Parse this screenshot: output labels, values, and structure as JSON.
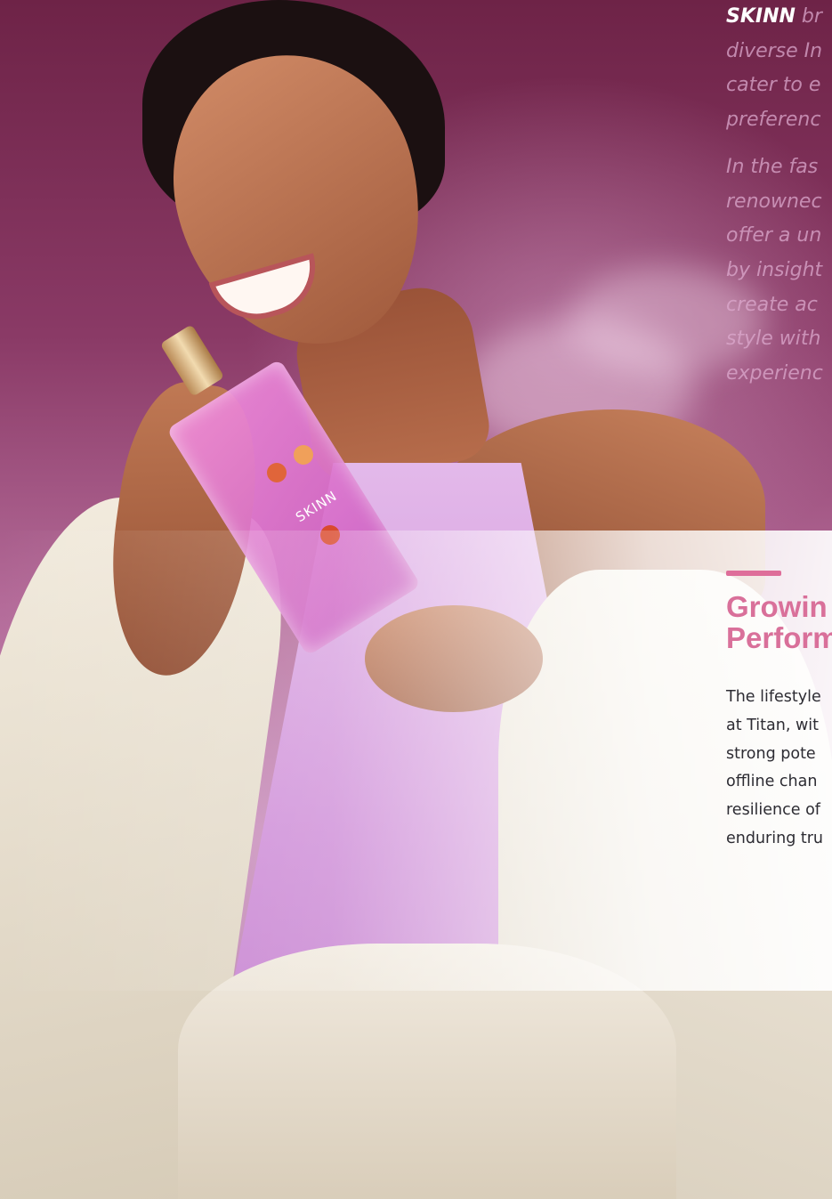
{
  "intro": {
    "brand": "SKINN",
    "paragraph1_rest": [
      " br",
      "diverse In",
      "cater to e",
      "preferenc"
    ],
    "paragraph2": [
      "In the fas",
      "renownec",
      "offer a un",
      "by insight",
      "create ac",
      "style with",
      "experienc"
    ]
  },
  "product": {
    "bottle_label": "SKINN"
  },
  "section": {
    "heading_lines": [
      "Growin",
      "Perform"
    ],
    "body_lines": [
      "The lifestyle",
      "at Titan, wit",
      "strong pote",
      "offline chan",
      "resilience of",
      "enduring tru"
    ]
  },
  "colors": {
    "accent": "#de6e9a",
    "heading": "#d9709a",
    "background": "#7a2a52"
  }
}
